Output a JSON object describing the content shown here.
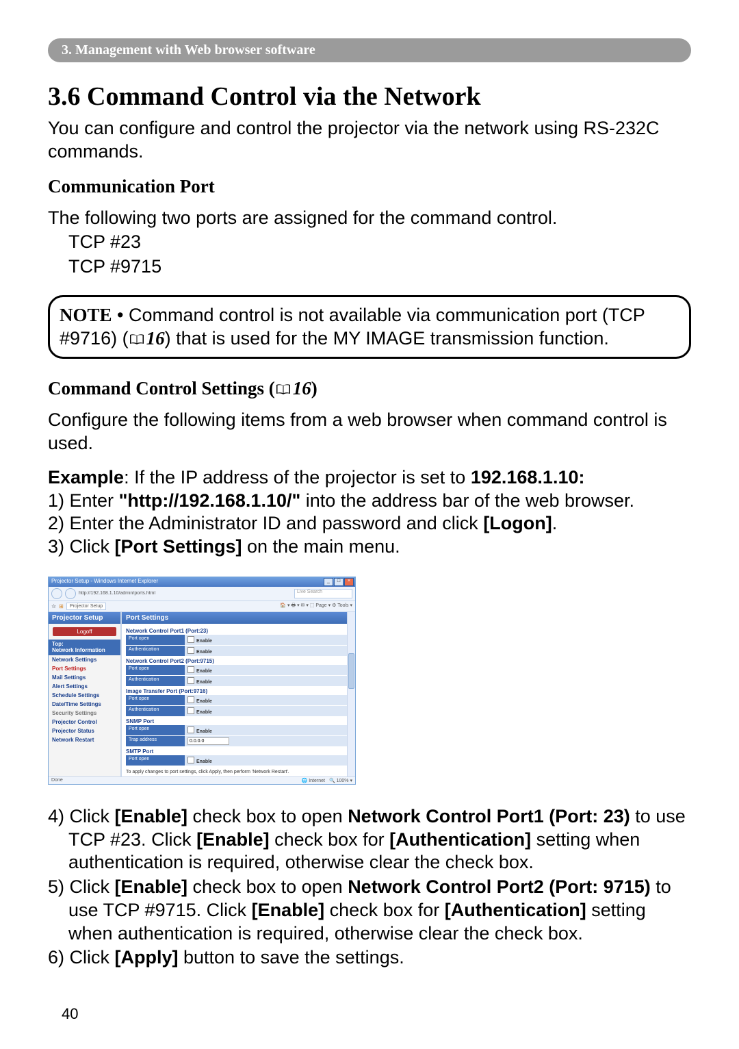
{
  "chapter_bar": "3. Management with Web browser software",
  "section_title": "3.6 Command Control via the Network",
  "intro": "You can configure and control the projector via the network using RS-232C commands.",
  "comm_port_heading": "Communication Port",
  "comm_port_text": "The following two ports are assigned for the command control.",
  "ports": [
    "TCP #23",
    "TCP #9715"
  ],
  "note": {
    "label": "NOTE",
    "bullet": "  •  ",
    "text1": "Command control is not available via communication port (TCP #9716) (",
    "ref": "16",
    "text2": ") that is used for the MY IMAGE transmission function."
  },
  "cmd_settings": {
    "heading": "Command Control Settings (",
    "ref": "16",
    "heading_close": ")",
    "intro": "Configure the following items from a web browser when command control is used.",
    "example_label": "Example",
    "example_text": ": If the IP address of the projector is set to ",
    "example_ip": "192.168.1.10:",
    "steps123": [
      {
        "n": "1) ",
        "pre": "Enter ",
        "bold": "\"http://192.168.1.10/\"",
        "post": " into the address bar of the web browser."
      },
      {
        "n": "2) ",
        "pre": "Enter the Administrator ID and password and click ",
        "bold": "[Logon]",
        "post": "."
      },
      {
        "n": "3) ",
        "pre": "Click ",
        "bold": "[Port Settings]",
        "post": " on the main menu."
      }
    ],
    "steps456": [
      {
        "n": "4) ",
        "pre": "Click ",
        "b1": "[Enable]",
        "t1": " check box to open ",
        "b2": "Network Control Port1 (Port: 23)",
        "t2": " to use TCP #23. Click ",
        "b3": "[Enable]",
        "t3": " check box for ",
        "b4": "[Authentication]",
        "t4": " setting when authentication is required, otherwise clear the check box."
      },
      {
        "n": "5) ",
        "pre": "Click ",
        "b1": "[Enable]",
        "t1": " check box to open ",
        "b2": "Network Control Port2 (Port: 9715)",
        "t2": " to use TCP #9715. Click ",
        "b3": "[Enable]",
        "t3": " check box for ",
        "b4": "[Authentication]",
        "t4": " setting when authentication is required, otherwise clear the check box."
      },
      {
        "n": "6) ",
        "pre": "Click ",
        "b1": "[Apply]",
        "t1": " button to save the settings.",
        "b2": "",
        "t2": "",
        "b3": "",
        "t3": "",
        "b4": "",
        "t4": ""
      }
    ]
  },
  "ie": {
    "title": "Projector Setup - Windows Internet Explorer",
    "url": "http://192.168.1.10/admin/ports.html",
    "search_ph": "Live Search",
    "tab": "Projector Setup",
    "toolbar_right": "🏠 ▾  🖶 ▾  ✉ ▾ ⬚ Page ▾ ⚙ Tools ▾",
    "side_header": "Projector Setup",
    "logoff": "Logoff",
    "top_block": "Top:\nNetwork Information",
    "links": [
      "Network Settings",
      "Port Settings",
      "Mail Settings",
      "Alert Settings",
      "Schedule Settings",
      "Date/Time Settings",
      "Security Settings",
      "Projector Control",
      "Projector Status",
      "Network Restart"
    ],
    "main_header": "Port Settings",
    "nc1": "Network Control Port1 (Port:23)",
    "nc2": "Network Control Port2 (Port:9715)",
    "itp": "Image Transfer Port (Port:9716)",
    "snmp": "SNMP Port",
    "smtp": "SMTP Port",
    "port_open": "Port open",
    "auth": "Authentication",
    "trap": "Trap address",
    "enable": "Enable",
    "trap_val": "0.0.0.0",
    "foot": "To apply changes to port settings, click Apply, then perform 'Network Restart'.",
    "status_left": "Done",
    "status_right_internet": "Internet",
    "status_right_zoom": "100%  ▾"
  },
  "page_number": "40"
}
